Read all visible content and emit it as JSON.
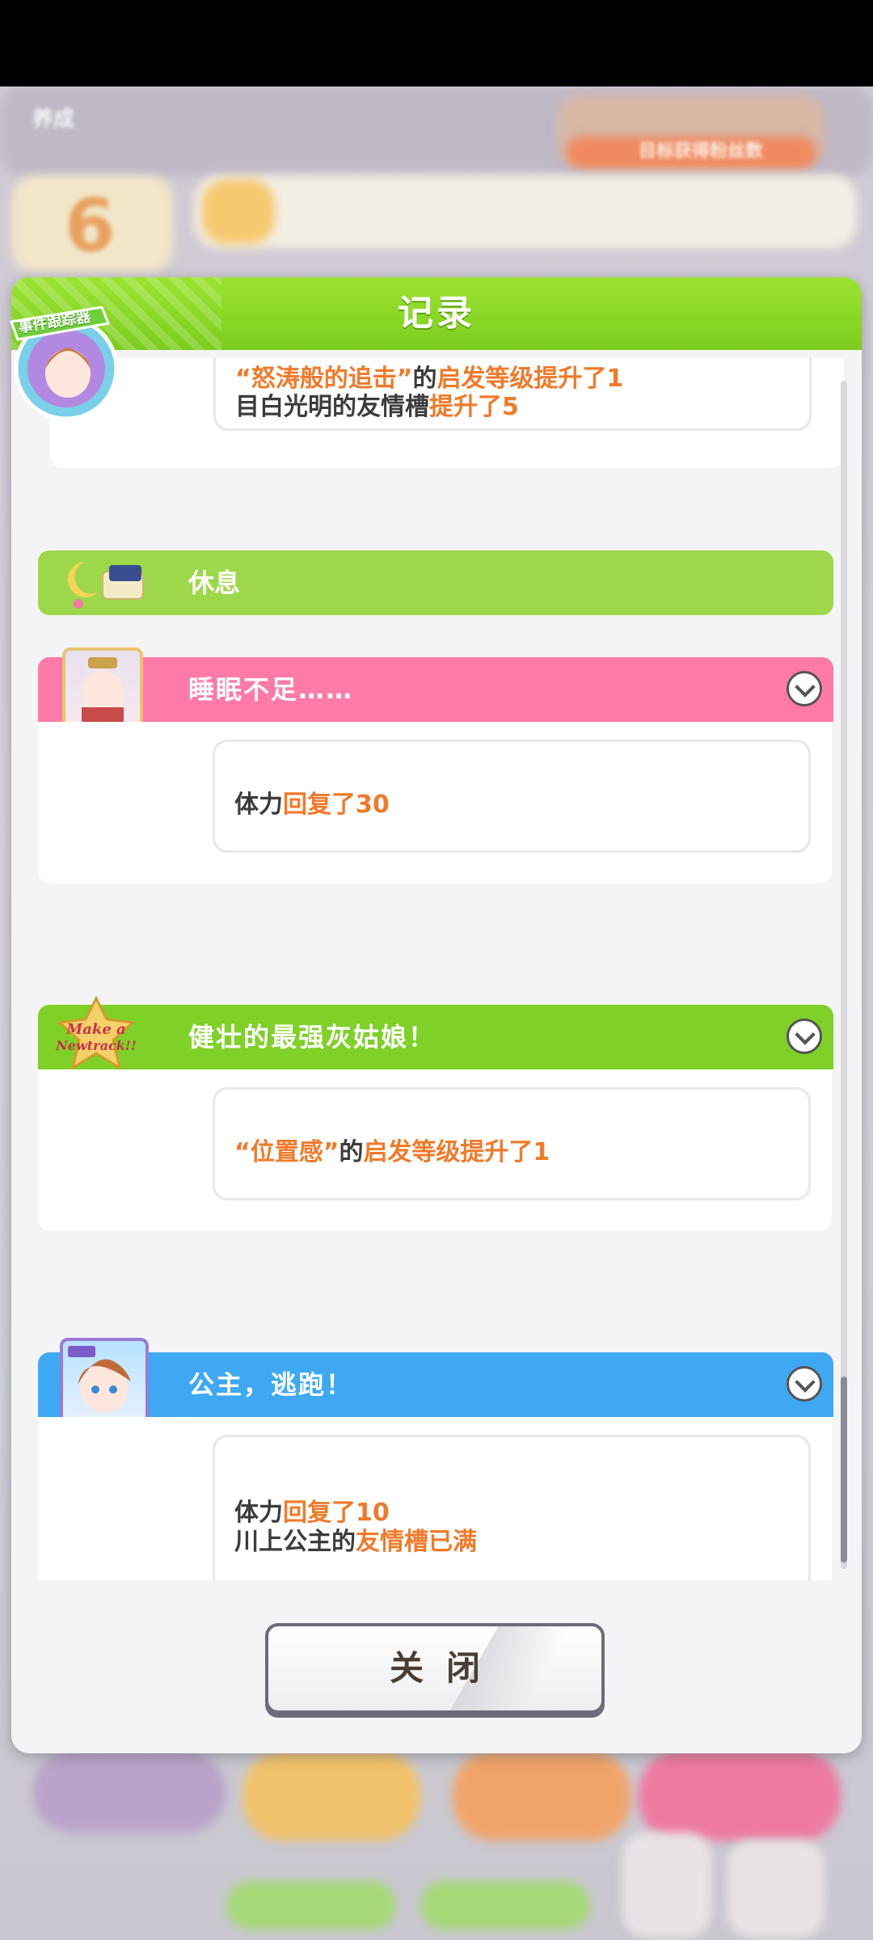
{
  "background": {
    "top_left_label": "养成",
    "day_number": "6",
    "banner_text": "目标获得粉丝数"
  },
  "badge": {
    "label": "事件跟踪器"
  },
  "dialog": {
    "title": "记录",
    "close_label": "关闭"
  },
  "entries": [
    {
      "lines": [
        {
          "parts": [
            {
              "text": "“怒涛般的追击”",
              "hl": true
            },
            {
              "text": "的",
              "hl": false
            },
            {
              "text": "启发等级提升了1",
              "hl": true
            }
          ]
        },
        {
          "parts": [
            {
              "text": "目白光明的友情槽",
              "hl": false
            },
            {
              "text": "提升了5",
              "hl": true
            }
          ]
        }
      ]
    }
  ],
  "rest_section": {
    "label": "休息"
  },
  "events": [
    {
      "title": "睡眠不足……",
      "color": "#ff7aa6",
      "lines": [
        {
          "a": "体力",
          "b": "回复了30"
        }
      ]
    },
    {
      "title": "健壮的最强灰姑娘！",
      "color": "#7fd028",
      "line": {
        "a": "“位置感”",
        "b": "的",
        "c": "启发等级提升了1"
      }
    },
    {
      "title": "公主，逃跑！",
      "color": "#3fa8f2",
      "lines": [
        {
          "a": "体力",
          "b": "回复了10"
        },
        {
          "a": "川上公主的",
          "b": "友情槽已满"
        }
      ]
    }
  ],
  "colors": {
    "header_green": "#86d424",
    "highlight_orange": "#f07a2a",
    "rest_bar": "#9dd84a"
  }
}
